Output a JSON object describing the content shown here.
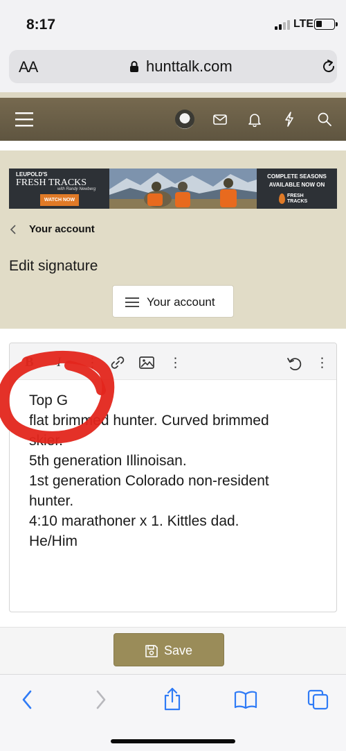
{
  "status_bar": {
    "time": "8:17",
    "network": "LTE"
  },
  "browser": {
    "text_size_label": "AA",
    "url": "hunttalk.com"
  },
  "banner": {
    "brand": "LEUPOLD'S",
    "show_title": "FRESH TRACKS",
    "host": "with Randy Newberg",
    "cta": "WATCH NOW",
    "tagline": "COMPLETE SEASONS AVAILABLE NOW ON",
    "logo_text": "FRESH TRACKS"
  },
  "breadcrumb": {
    "label": "Your account"
  },
  "page": {
    "title": "Edit signature"
  },
  "account_menu": {
    "label": "Your account"
  },
  "editor": {
    "lines": [
      "Top G",
      "flat brimmed hunter. Curved brimmed",
      "skier.",
      "5th generation Illinoisan.",
      "1st generation Colorado non-resident",
      "hunter.",
      "4:10 marathoner x 1. Kittles dad.",
      "He/Him"
    ]
  },
  "save": {
    "label": "Save"
  },
  "colors": {
    "header": "#6b5f48",
    "beige": "#e1dcc7",
    "save_button": "#9a8c59",
    "scribble": "#e3261c",
    "ios_blue": "#2f7bf6"
  }
}
